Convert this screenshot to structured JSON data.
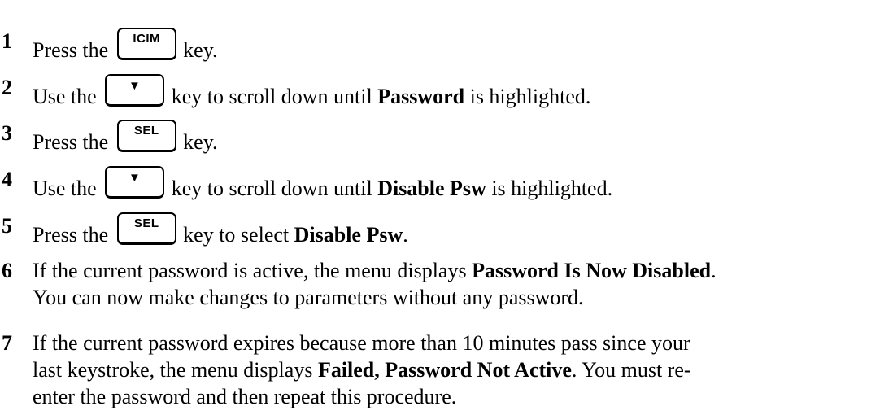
{
  "steps": [
    {
      "num": "1",
      "pre": "Press the",
      "key": "ICIM",
      "post": "key."
    },
    {
      "num": "2",
      "pre": "Use the",
      "key": "▼",
      "post": "key to scroll down until",
      "bold": "Password",
      "post2": "is highlighted."
    },
    {
      "num": "3",
      "pre": "Press the",
      "key": "SEL",
      "post": "key."
    },
    {
      "num": "4",
      "pre": "Use the",
      "key": "▼",
      "post": "key to scroll down until",
      "bold": "Disable Psw",
      "post2": "is highlighted."
    },
    {
      "num": "5",
      "pre": "Press the",
      "key": "SEL",
      "post": "key to select",
      "bold": "Disable Psw",
      "post2": "."
    },
    {
      "num": "6",
      "l1_text": "If the current password is active, the menu displays",
      "l1_bold": "Password Is Now Disabled",
      "l1_end": ".",
      "l2": "You can now make changes to parameters without any password."
    },
    {
      "num": "7",
      "l1": "If the current password expires because more than 10 minutes pass since your",
      "l2_text": "last keystroke, the menu displays",
      "l2_bold": "Failed, Password Not Active",
      "l2_end": ". You must re-",
      "l3": "enter the password and then repeat this procedure."
    }
  ]
}
